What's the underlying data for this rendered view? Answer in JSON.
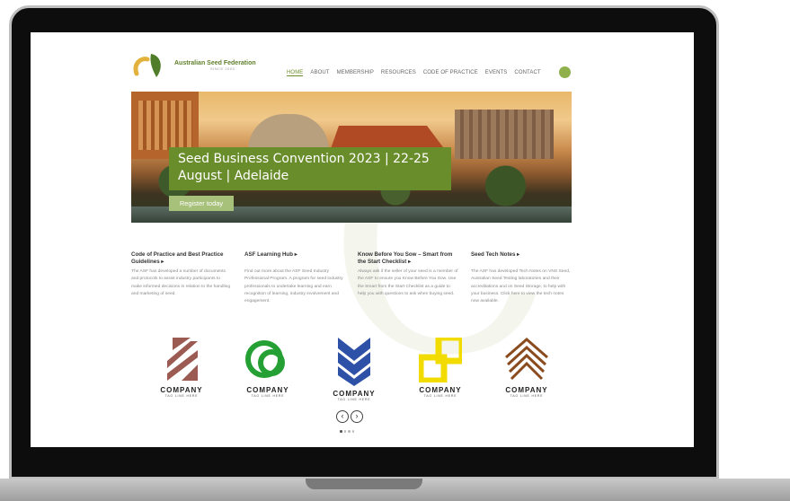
{
  "site": {
    "logo_title": "Australian Seed Federation",
    "logo_subtitle": "SINCE 2003",
    "nav": [
      "HOME",
      "ABOUT",
      "MEMBERSHIP",
      "RESOURCES",
      "CODE OF PRACTICE",
      "EVENTS",
      "CONTACT"
    ],
    "active_nav": "HOME"
  },
  "hero": {
    "headline": "Seed Business Convention 2023 | 22-25 August | Adelaide",
    "cta": "Register today"
  },
  "columns": [
    {
      "title": "Code of Practice and Best Practice Guidelines",
      "arrow": "▸",
      "body": "The ASF has developed a number of documents and protocols to assist industry participants to make informed decisions in relation to the handling and marketing of seed."
    },
    {
      "title": "ASF Learning Hub",
      "arrow": "▸",
      "body": "Find out more about the ASF Seed Industry Professional Program. A program for seed industry professionals to undertake learning and earn recognition of learning, industry involvement and engagement."
    },
    {
      "title": "Know Before You Sow – Smart from the Start Checklist",
      "arrow": "▸",
      "body": "Always ask if the seller of your seed is a member of the ASF to ensure you Know Before You Sow. Use the Smart from the Start Checklist as a guide to help you with questions to ask when buying seed."
    },
    {
      "title": "Seed Tech Notes",
      "arrow": "▸",
      "body": "The ASF has developed Tech Notes on VNS Seed, Australian Seed Testing laboratories and their accreditations and on Seed Storage, to help with your business. Click here to view the tech notes now available."
    }
  ],
  "partners": [
    {
      "name": "COMPANY",
      "tagline": "TAG LINE HERE",
      "icon": "stripes-logo-icon",
      "color": "#9c5b52"
    },
    {
      "name": "COMPANY",
      "tagline": "TAG LINE HERE",
      "icon": "rings-logo-icon",
      "color": "#25a035"
    },
    {
      "name": "COMPANY",
      "tagline": "TAG LINE HERE",
      "icon": "chevron-shield-logo-icon",
      "color": "#2e51a8"
    },
    {
      "name": "COMPANY",
      "tagline": "TAG LINE HERE",
      "icon": "square-blocks-logo-icon",
      "color": "#f2dc00"
    },
    {
      "name": "COMPANY",
      "tagline": "TAG LINE HERE",
      "icon": "house-stripes-logo-icon",
      "color": "#8a4b1f"
    }
  ],
  "carousel": {
    "prev": "‹",
    "next": "›",
    "dots": 4,
    "active_dot": 0
  },
  "colors": {
    "brand_green": "#6a8d2c",
    "laptop_bezel": "#0d0d0d"
  }
}
